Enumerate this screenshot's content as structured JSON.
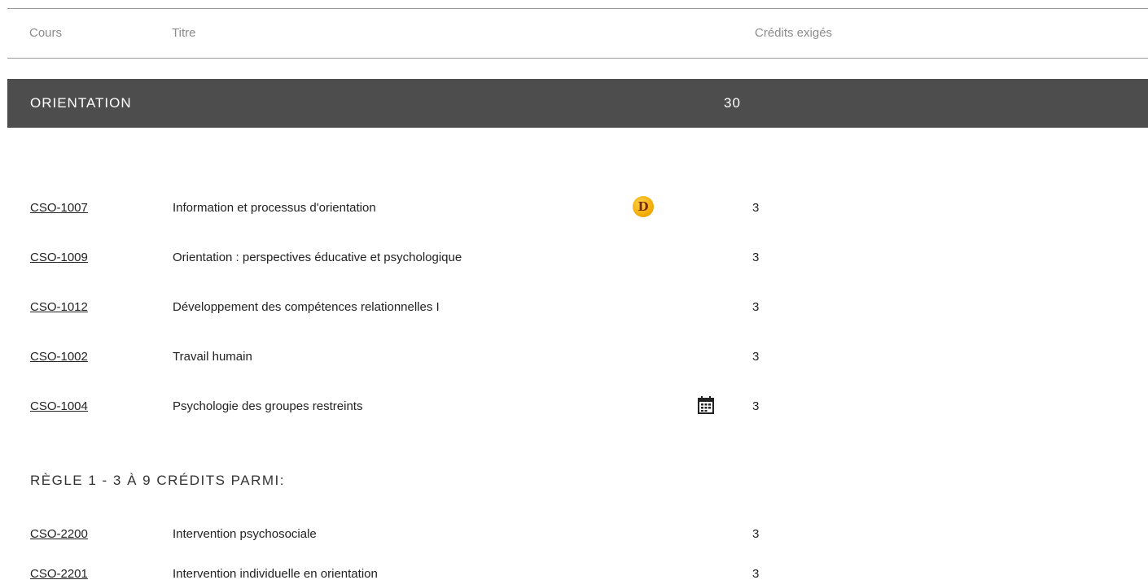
{
  "table_header": {
    "cours": "Cours",
    "titre": "Titre",
    "credits": "Crédits exigés"
  },
  "section": {
    "title": "ORIENTATION",
    "credits": "30"
  },
  "courses": [
    {
      "code": "CSO-1007",
      "title": "Information et processus d'orientation",
      "credits": "3",
      "badge": "D"
    },
    {
      "code": "CSO-1009",
      "title": "Orientation : perspectives éducative et psychologique",
      "credits": "3"
    },
    {
      "code": "CSO-1012",
      "title": "Développement des compétences relationnelles I",
      "credits": "3"
    },
    {
      "code": "CSO-1002",
      "title": "Travail humain",
      "credits": "3"
    },
    {
      "code": "CSO-1004",
      "title": "Psychologie des groupes restreints",
      "credits": "3",
      "icon": "calendar-icon"
    }
  ],
  "rule": {
    "heading": "RÈGLE 1 - 3 À 9 CRÉDITS PARMI:",
    "courses": [
      {
        "code": "CSO-2200",
        "title": "Intervention psychosociale",
        "credits": "3"
      },
      {
        "code": "CSO-2201",
        "title": "Intervention individuelle en orientation",
        "credits": "3"
      }
    ]
  },
  "colors": {
    "section_bar": "#4d4d4d",
    "header_text": "#8c8c8c",
    "badge": "#f0a800"
  }
}
